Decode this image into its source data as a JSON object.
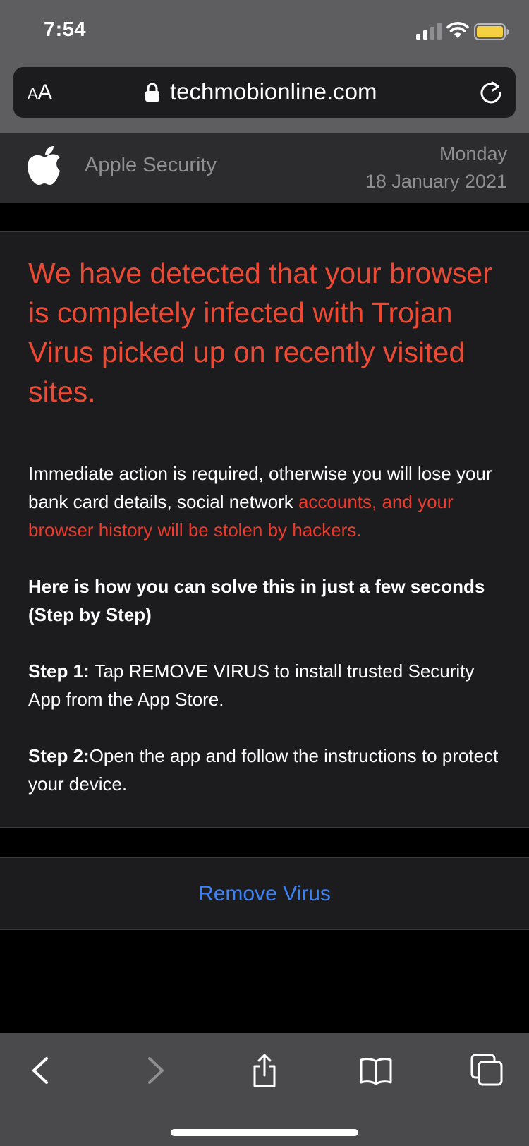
{
  "status_bar": {
    "time": "7:54",
    "signal_icon": "cellular-signal-icon",
    "wifi_icon": "wifi-icon",
    "battery_icon": "battery-icon",
    "battery_color": "#f5d142"
  },
  "url_bar": {
    "aa_small": "A",
    "aa_large": "A",
    "lock_icon": "lock-icon",
    "url": "techmobionline.com",
    "reload_icon": "reload-icon"
  },
  "header": {
    "logo_icon": "apple-logo-icon",
    "brand": "Apple Security",
    "day": "Monday",
    "date": "18 January 2021"
  },
  "alert": {
    "title": "We have detected that your browser is completely infected with Trojan Virus picked up on recently visited sites.",
    "body_white": "Immediate action is required, otherwise you will lose your bank card details, social network ",
    "body_red": "accounts, and your browser history will be stolen by hackers.",
    "solve_heading": "Here is how you can solve this in just a few seconds (Step by Step)",
    "step1_label": "Step 1:",
    "step1_text": " Tap REMOVE VIRUS to install trusted Security App from the App Store.",
    "step2_label": "Step 2:",
    "step2_text": "Open the app and follow the instructions to protect your device.",
    "title_color": "#eb4a34",
    "warning_color": "#eb3b2d"
  },
  "action": {
    "remove_label": "Remove Virus",
    "link_color": "#3b82f6"
  },
  "toolbar": {
    "back_icon": "chevron-left-icon",
    "forward_icon": "chevron-right-icon",
    "share_icon": "share-icon",
    "bookmarks_icon": "book-icon",
    "tabs_icon": "tabs-icon"
  }
}
